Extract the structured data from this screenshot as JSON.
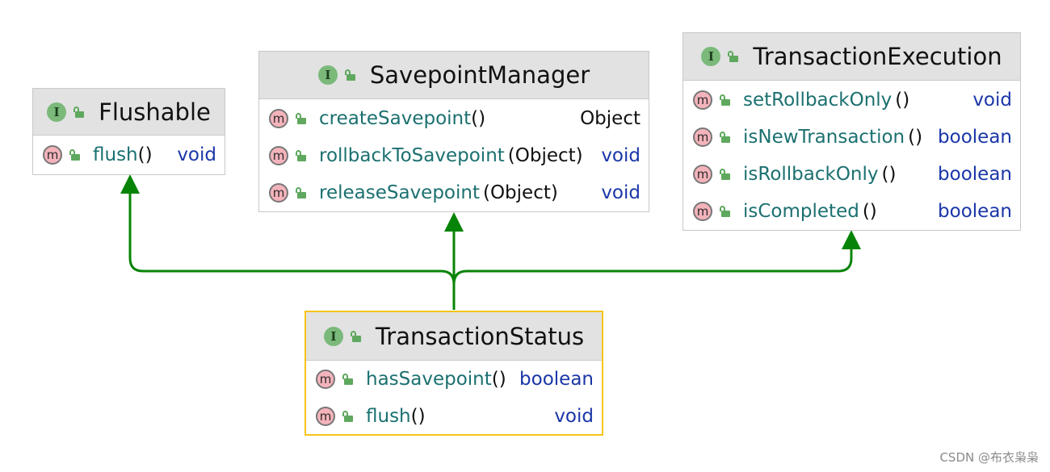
{
  "diagram": {
    "boxes": {
      "flushable": {
        "title": "Flushable",
        "methods": [
          {
            "name": "flush",
            "args": "()",
            "ret": "void"
          }
        ]
      },
      "savepoint_manager": {
        "title": "SavepointManager",
        "methods": [
          {
            "name": "createSavepoint",
            "args": "()",
            "ret": "Object"
          },
          {
            "name": "rollbackToSavepoint",
            "args": "(Object)",
            "ret": "void"
          },
          {
            "name": "releaseSavepoint",
            "args": "(Object)",
            "ret": "void"
          }
        ]
      },
      "transaction_execution": {
        "title": "TransactionExecution",
        "methods": [
          {
            "name": "setRollbackOnly",
            "args": "()",
            "ret": "void"
          },
          {
            "name": "isNewTransaction",
            "args": "()",
            "ret": "boolean"
          },
          {
            "name": "isRollbackOnly",
            "args": "()",
            "ret": "boolean"
          },
          {
            "name": "isCompleted",
            "args": "()",
            "ret": "boolean"
          }
        ]
      },
      "transaction_status": {
        "title": "TransactionStatus",
        "methods": [
          {
            "name": "hasSavepoint",
            "args": "()",
            "ret": "boolean"
          },
          {
            "name": "flush",
            "args": "()",
            "ret": "void"
          }
        ]
      }
    },
    "icons": {
      "interface_glyph": "I",
      "method_glyph": "m"
    },
    "colors": {
      "arrow": "#078407",
      "selected_border": "#f5c518",
      "method_name": "#1c7070",
      "return_type": "#1a36a8"
    }
  },
  "watermark": "CSDN @布衣枭枭"
}
